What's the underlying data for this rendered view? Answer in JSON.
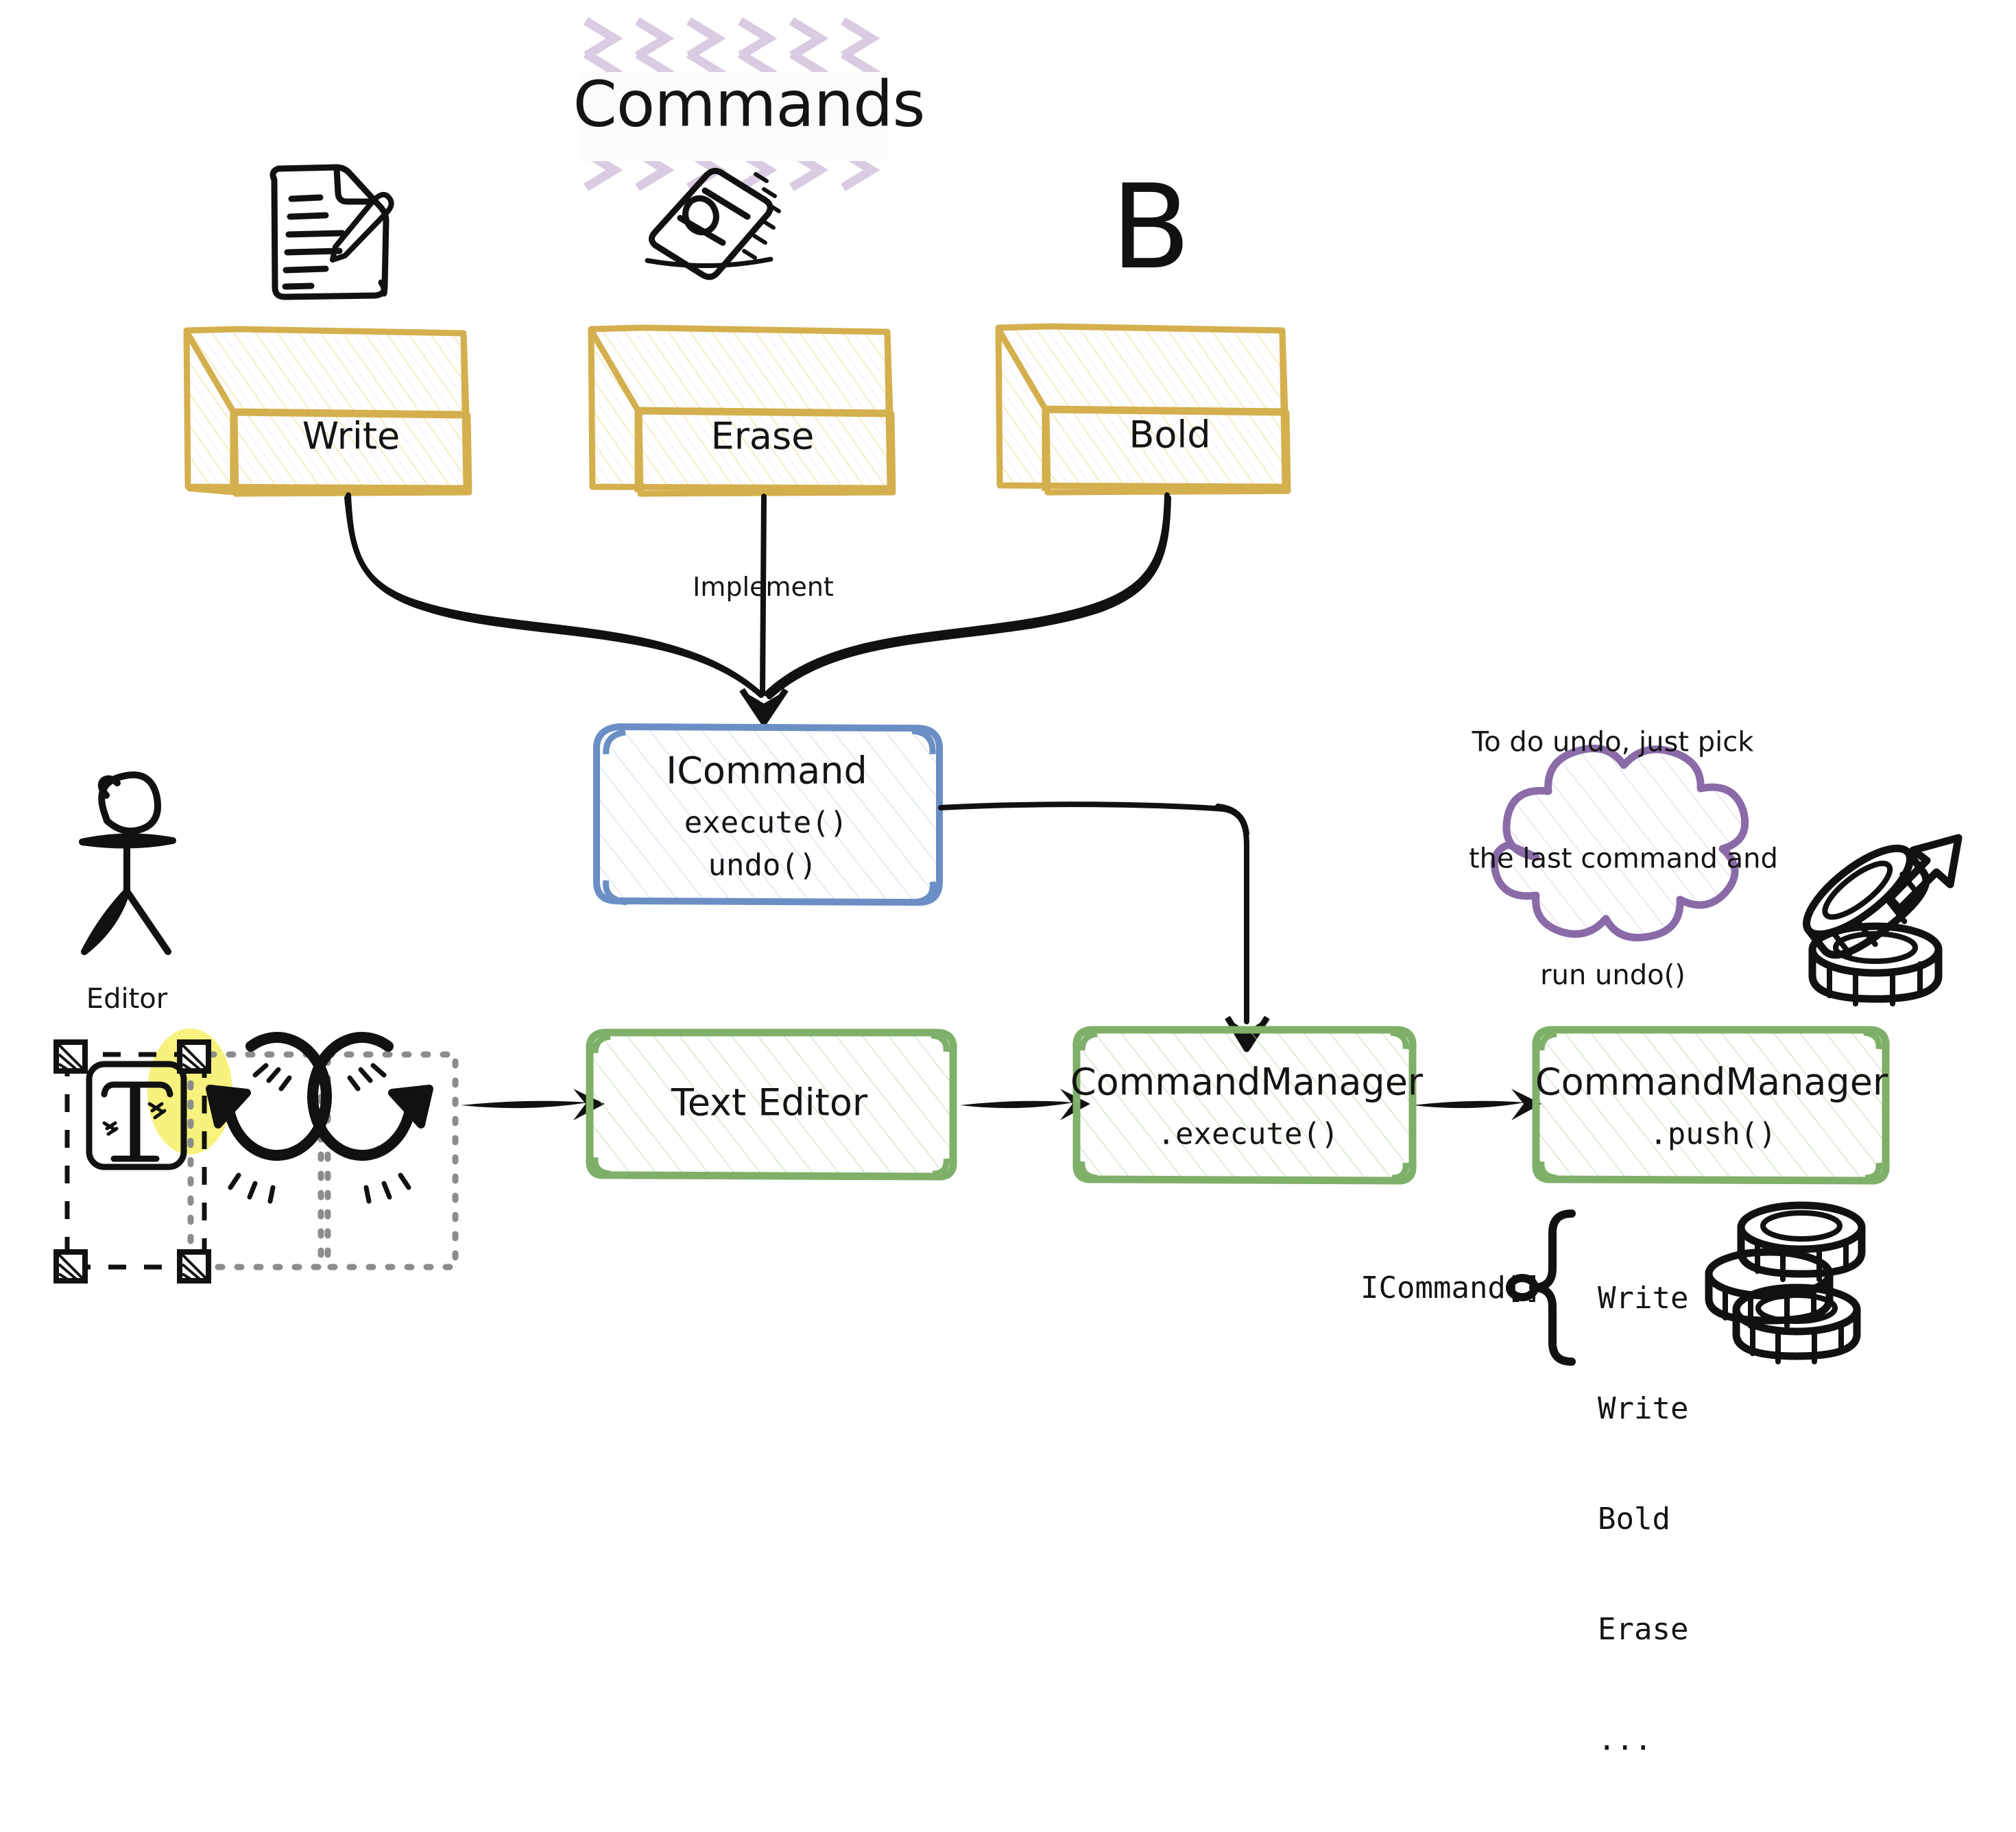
{
  "diagram": {
    "title": "Commands",
    "title_highlight_color": "#d8c9e0",
    "background": "#ffffff"
  },
  "command_boxes": [
    {
      "label": "Write",
      "icon": "document-pencil-icon",
      "color": "#d4af4e"
    },
    {
      "label": "Erase",
      "icon": "eraser-icon",
      "color": "#d4af4e"
    },
    {
      "label": "Bold",
      "icon": "bold-b-icon",
      "color": "#d4af4e"
    }
  ],
  "interface_box": {
    "title": "ICommand",
    "methods": [
      "execute()",
      "undo()"
    ],
    "color": "#6b8fc4"
  },
  "edges": {
    "implement_label": "Implement"
  },
  "actor": {
    "label": "Editor",
    "icon": "stick-figure-icon"
  },
  "toolbar": {
    "text_tool_icon": "text-tool-T-icon",
    "undo_icon": "undo-arrow-icon",
    "redo_icon": "redo-arrow-icon",
    "highlight_color": "#f7f27e"
  },
  "flow_boxes": [
    {
      "title": "Text Editor",
      "method": "",
      "color": "#7fb069"
    },
    {
      "title": "CommandManager",
      "method": ".execute()",
      "color": "#7fb069"
    },
    {
      "title": "CommandManager",
      "method": ".push()",
      "color": "#7fb069"
    }
  ],
  "note_cloud": {
    "lines": [
      "To do undo, just pick",
      "the last command and",
      "run undo()"
    ],
    "color": "#8a6ba8",
    "icon": "stack-pop-icon"
  },
  "stack": {
    "type_label": "ICommand[]",
    "items": [
      "Write",
      "Write",
      "Bold",
      "Erase",
      "..."
    ],
    "icon": "coin-stack-icon"
  }
}
